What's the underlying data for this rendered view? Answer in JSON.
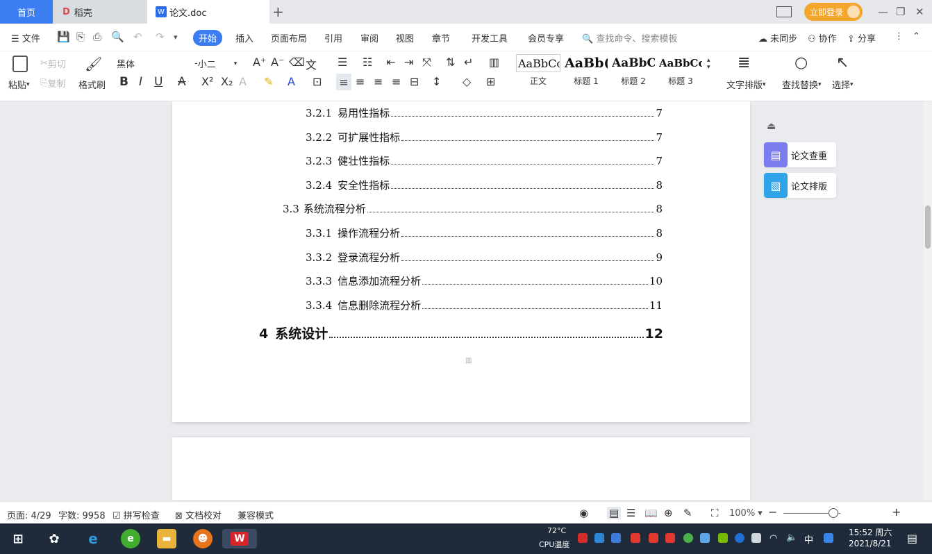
{
  "tabs": {
    "home": "首页",
    "daoke": "稻壳",
    "doc": "论文.doc",
    "login": "立即登录"
  },
  "menu": {
    "file": "文件",
    "items": [
      "开始",
      "插入",
      "页面布局",
      "引用",
      "审阅",
      "视图",
      "章节",
      "开发工具",
      "会员专享"
    ],
    "search": "查找命令、搜索模板",
    "sync": "未同步",
    "collab": "协作",
    "share": "分享"
  },
  "ribbon": {
    "paste": "粘贴",
    "cut": "剪切",
    "copy": "复制",
    "format_painter": "格式刷",
    "font": "黑体",
    "size": "小二",
    "styles": [
      {
        "sample": "AaBbCcI",
        "label": "正文"
      },
      {
        "sample": "AaBb(",
        "label": "标题 1"
      },
      {
        "sample": "AaBbC",
        "label": "标题 2"
      },
      {
        "sample": "AaBbCcl",
        "label": "标题 3"
      }
    ],
    "text_layout": "文字排版",
    "find_replace": "查找替换",
    "select": "选择"
  },
  "toc": [
    {
      "num": "3.2.1",
      "title": "易用性指标",
      "page": "7",
      "level": 3
    },
    {
      "num": "3.2.2",
      "title": "可扩展性指标",
      "page": "7",
      "level": 3
    },
    {
      "num": "3.2.3",
      "title": "健壮性指标",
      "page": "7",
      "level": 3
    },
    {
      "num": "3.2.4",
      "title": "安全性指标",
      "page": "8",
      "level": 3
    },
    {
      "num": "3.3",
      "title": "系统流程分析",
      "page": "8",
      "level": 2
    },
    {
      "num": "3.3.1",
      "title": "操作流程分析",
      "page": "8",
      "level": 3
    },
    {
      "num": "3.3.2",
      "title": "登录流程分析",
      "page": "9",
      "level": 3
    },
    {
      "num": "3.3.3",
      "title": "信息添加流程分析",
      "page": "10",
      "level": 3
    },
    {
      "num": "3.3.4",
      "title": "信息删除流程分析",
      "page": "11",
      "level": 3
    },
    {
      "num": "4",
      "title": "系统设计",
      "page": "12",
      "level": 1
    }
  ],
  "side_panel": {
    "check": "论文查重",
    "layout": "论文排版"
  },
  "status": {
    "page": "页面: 4/29",
    "words": "字数: 9958",
    "spell": "拼写检查",
    "proof": "文档校对",
    "compat": "兼容模式",
    "zoom": "100%"
  },
  "taskbar": {
    "cpu_temp": "72°C",
    "cpu_label": "CPU温度",
    "ime": "中",
    "time": "15:52 周六",
    "date": "2021/8/21"
  },
  "colors": {
    "accent": "#3c7ef1",
    "login": "#f3a52c",
    "taskbar": "#1f2a3a"
  }
}
